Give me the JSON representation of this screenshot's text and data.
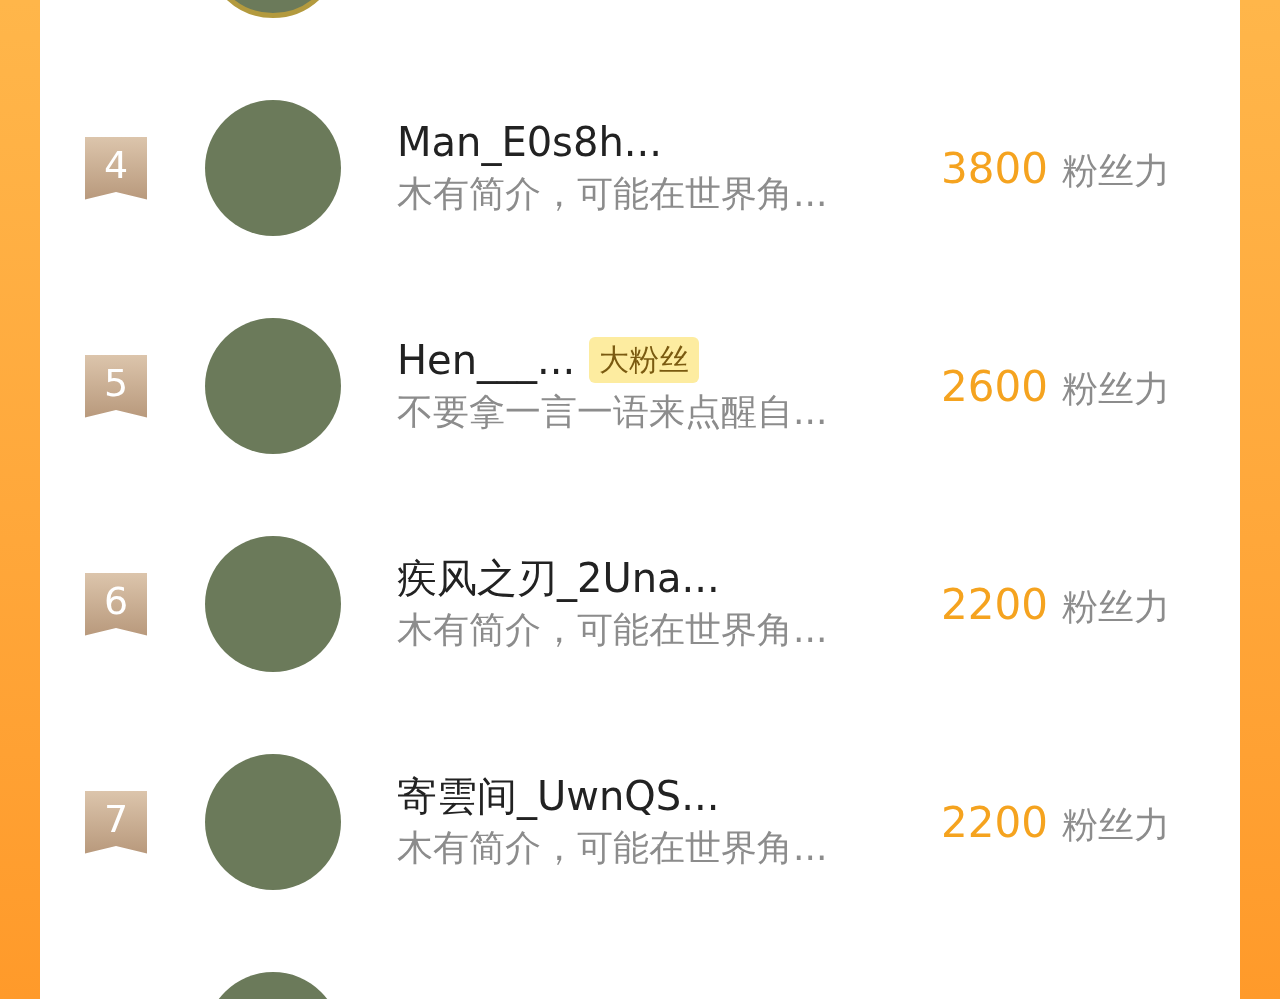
{
  "rows": [
    {
      "kind": "avatar_only",
      "ringed": true
    },
    {
      "kind": "full",
      "rank": "4",
      "name": "Man_E0s8h...",
      "badge": null,
      "bio": "木有简介，可能在世界角...",
      "score": "3800",
      "unit": "粉丝力"
    },
    {
      "kind": "full",
      "rank": "5",
      "name": "Hen___...",
      "badge": "大粉丝",
      "bio": "不要拿一言一语来点醒自...",
      "score": "2600",
      "unit": "粉丝力"
    },
    {
      "kind": "full",
      "rank": "6",
      "name": "疾风之刃_2Una...",
      "badge": null,
      "bio": "木有简介，可能在世界角...",
      "score": "2200",
      "unit": "粉丝力"
    },
    {
      "kind": "full",
      "rank": "7",
      "name": "寄雲间_UwnQS...",
      "badge": null,
      "bio": "木有简介，可能在世界角...",
      "score": "2200",
      "unit": "粉丝力"
    },
    {
      "kind": "avatar_only",
      "ringed": false
    }
  ]
}
